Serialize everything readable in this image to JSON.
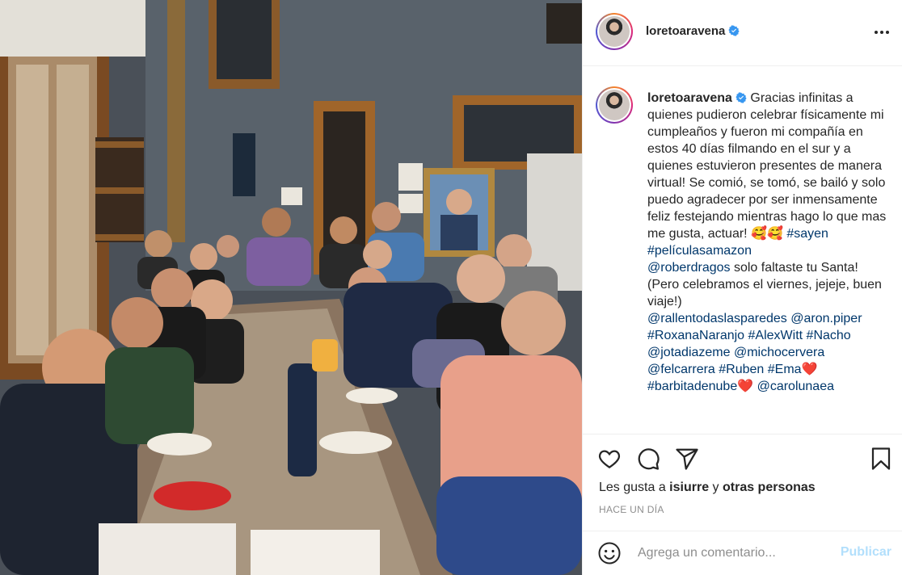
{
  "post": {
    "username": "loretoaravena",
    "verified": true
  },
  "caption": {
    "username": "loretoaravena",
    "text": "Gracias infinitas a quienes pudieron celebrar físicamente mi cumpleaños y fueron mi compañía en estos 40 días filmando en el sur y a quienes estuvieron presentes de manera virtual! Se comió, se tomó, se bailó y solo puedo agradecer por ser inmensamente feliz festejando mientras hago lo que mas me gusta, actuar! 🥰🥰 ",
    "hashtags_1": "#sayen #películasamazon",
    "mention_line": "@roberdragos",
    "text_2": " solo faltaste tu Santa! (Pero celebramos el viernes, jejeje, buen viaje!)",
    "tags": "@rallentodaslasparedes @aron.piper #RoxanaNaranjo #AlexWitt #Nacho @jotadiazeme @michocervera @felcarrera #Ruben #Ema❤️ #barbitadenube❤️ @carolunaea"
  },
  "actions": {
    "likes_prefix": "Les gusta a ",
    "likes_user": "isiurre",
    "likes_middle": " y ",
    "likes_others": "otras personas",
    "date": "HACE UN DÍA",
    "icons": [
      "heart-icon",
      "comment-icon",
      "share-icon",
      "bookmark-icon"
    ]
  },
  "comment": {
    "placeholder": "Agrega un comentario...",
    "publish_label": "Publicar"
  },
  "colors": {
    "link": "#00376b",
    "verified": "#3897f0",
    "publish_disabled": "#b2dffc"
  }
}
